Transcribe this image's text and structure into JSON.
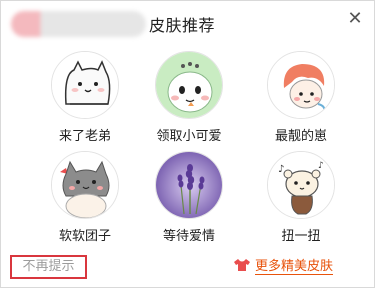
{
  "dialog": {
    "title": "皮肤推荐",
    "close_glyph": "✕"
  },
  "skins": [
    {
      "label": "来了老弟",
      "icon": "white-cat-sticker-icon"
    },
    {
      "label": "领取小可爱",
      "icon": "green-cartoon-sticker-icon"
    },
    {
      "label": "最靓的崽",
      "icon": "red-hair-sticker-icon"
    },
    {
      "label": "软软团子",
      "icon": "kitten-sticker-icon"
    },
    {
      "label": "等待爱情",
      "icon": "lavender-photo-icon"
    },
    {
      "label": "扭一扭",
      "icon": "dancing-bear-sticker-icon"
    }
  ],
  "footer": {
    "no_remind": "不再提示",
    "more_link": "更多精美皮肤",
    "more_icon": "skin-shirt-icon",
    "accent": "#e8530c",
    "highlight_border": "#d9363e"
  }
}
